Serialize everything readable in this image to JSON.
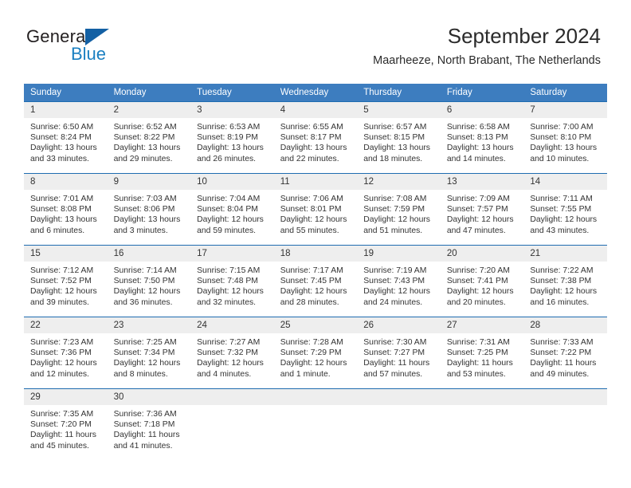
{
  "brand": {
    "name_part1": "General",
    "name_part2": "Blue",
    "flag_icon": "blue-triangle-flag-icon"
  },
  "header": {
    "title": "September 2024",
    "subtitle": "Maarheeze, North Brabant, The Netherlands"
  },
  "colors": {
    "header_blue": "#3d7dbf",
    "row_divider_blue": "#1f6cb0",
    "daynum_band": "#eeeeee",
    "brand_blue": "#1a7fc1"
  },
  "weekdays": [
    "Sunday",
    "Monday",
    "Tuesday",
    "Wednesday",
    "Thursday",
    "Friday",
    "Saturday"
  ],
  "weeks": [
    [
      {
        "day": "1",
        "sunrise": "Sunrise: 6:50 AM",
        "sunset": "Sunset: 8:24 PM",
        "daylight1": "Daylight: 13 hours",
        "daylight2": "and 33 minutes."
      },
      {
        "day": "2",
        "sunrise": "Sunrise: 6:52 AM",
        "sunset": "Sunset: 8:22 PM",
        "daylight1": "Daylight: 13 hours",
        "daylight2": "and 29 minutes."
      },
      {
        "day": "3",
        "sunrise": "Sunrise: 6:53 AM",
        "sunset": "Sunset: 8:19 PM",
        "daylight1": "Daylight: 13 hours",
        "daylight2": "and 26 minutes."
      },
      {
        "day": "4",
        "sunrise": "Sunrise: 6:55 AM",
        "sunset": "Sunset: 8:17 PM",
        "daylight1": "Daylight: 13 hours",
        "daylight2": "and 22 minutes."
      },
      {
        "day": "5",
        "sunrise": "Sunrise: 6:57 AM",
        "sunset": "Sunset: 8:15 PM",
        "daylight1": "Daylight: 13 hours",
        "daylight2": "and 18 minutes."
      },
      {
        "day": "6",
        "sunrise": "Sunrise: 6:58 AM",
        "sunset": "Sunset: 8:13 PM",
        "daylight1": "Daylight: 13 hours",
        "daylight2": "and 14 minutes."
      },
      {
        "day": "7",
        "sunrise": "Sunrise: 7:00 AM",
        "sunset": "Sunset: 8:10 PM",
        "daylight1": "Daylight: 13 hours",
        "daylight2": "and 10 minutes."
      }
    ],
    [
      {
        "day": "8",
        "sunrise": "Sunrise: 7:01 AM",
        "sunset": "Sunset: 8:08 PM",
        "daylight1": "Daylight: 13 hours",
        "daylight2": "and 6 minutes."
      },
      {
        "day": "9",
        "sunrise": "Sunrise: 7:03 AM",
        "sunset": "Sunset: 8:06 PM",
        "daylight1": "Daylight: 13 hours",
        "daylight2": "and 3 minutes."
      },
      {
        "day": "10",
        "sunrise": "Sunrise: 7:04 AM",
        "sunset": "Sunset: 8:04 PM",
        "daylight1": "Daylight: 12 hours",
        "daylight2": "and 59 minutes."
      },
      {
        "day": "11",
        "sunrise": "Sunrise: 7:06 AM",
        "sunset": "Sunset: 8:01 PM",
        "daylight1": "Daylight: 12 hours",
        "daylight2": "and 55 minutes."
      },
      {
        "day": "12",
        "sunrise": "Sunrise: 7:08 AM",
        "sunset": "Sunset: 7:59 PM",
        "daylight1": "Daylight: 12 hours",
        "daylight2": "and 51 minutes."
      },
      {
        "day": "13",
        "sunrise": "Sunrise: 7:09 AM",
        "sunset": "Sunset: 7:57 PM",
        "daylight1": "Daylight: 12 hours",
        "daylight2": "and 47 minutes."
      },
      {
        "day": "14",
        "sunrise": "Sunrise: 7:11 AM",
        "sunset": "Sunset: 7:55 PM",
        "daylight1": "Daylight: 12 hours",
        "daylight2": "and 43 minutes."
      }
    ],
    [
      {
        "day": "15",
        "sunrise": "Sunrise: 7:12 AM",
        "sunset": "Sunset: 7:52 PM",
        "daylight1": "Daylight: 12 hours",
        "daylight2": "and 39 minutes."
      },
      {
        "day": "16",
        "sunrise": "Sunrise: 7:14 AM",
        "sunset": "Sunset: 7:50 PM",
        "daylight1": "Daylight: 12 hours",
        "daylight2": "and 36 minutes."
      },
      {
        "day": "17",
        "sunrise": "Sunrise: 7:15 AM",
        "sunset": "Sunset: 7:48 PM",
        "daylight1": "Daylight: 12 hours",
        "daylight2": "and 32 minutes."
      },
      {
        "day": "18",
        "sunrise": "Sunrise: 7:17 AM",
        "sunset": "Sunset: 7:45 PM",
        "daylight1": "Daylight: 12 hours",
        "daylight2": "and 28 minutes."
      },
      {
        "day": "19",
        "sunrise": "Sunrise: 7:19 AM",
        "sunset": "Sunset: 7:43 PM",
        "daylight1": "Daylight: 12 hours",
        "daylight2": "and 24 minutes."
      },
      {
        "day": "20",
        "sunrise": "Sunrise: 7:20 AM",
        "sunset": "Sunset: 7:41 PM",
        "daylight1": "Daylight: 12 hours",
        "daylight2": "and 20 minutes."
      },
      {
        "day": "21",
        "sunrise": "Sunrise: 7:22 AM",
        "sunset": "Sunset: 7:38 PM",
        "daylight1": "Daylight: 12 hours",
        "daylight2": "and 16 minutes."
      }
    ],
    [
      {
        "day": "22",
        "sunrise": "Sunrise: 7:23 AM",
        "sunset": "Sunset: 7:36 PM",
        "daylight1": "Daylight: 12 hours",
        "daylight2": "and 12 minutes."
      },
      {
        "day": "23",
        "sunrise": "Sunrise: 7:25 AM",
        "sunset": "Sunset: 7:34 PM",
        "daylight1": "Daylight: 12 hours",
        "daylight2": "and 8 minutes."
      },
      {
        "day": "24",
        "sunrise": "Sunrise: 7:27 AM",
        "sunset": "Sunset: 7:32 PM",
        "daylight1": "Daylight: 12 hours",
        "daylight2": "and 4 minutes."
      },
      {
        "day": "25",
        "sunrise": "Sunrise: 7:28 AM",
        "sunset": "Sunset: 7:29 PM",
        "daylight1": "Daylight: 12 hours",
        "daylight2": "and 1 minute."
      },
      {
        "day": "26",
        "sunrise": "Sunrise: 7:30 AM",
        "sunset": "Sunset: 7:27 PM",
        "daylight1": "Daylight: 11 hours",
        "daylight2": "and 57 minutes."
      },
      {
        "day": "27",
        "sunrise": "Sunrise: 7:31 AM",
        "sunset": "Sunset: 7:25 PM",
        "daylight1": "Daylight: 11 hours",
        "daylight2": "and 53 minutes."
      },
      {
        "day": "28",
        "sunrise": "Sunrise: 7:33 AM",
        "sunset": "Sunset: 7:22 PM",
        "daylight1": "Daylight: 11 hours",
        "daylight2": "and 49 minutes."
      }
    ],
    [
      {
        "day": "29",
        "sunrise": "Sunrise: 7:35 AM",
        "sunset": "Sunset: 7:20 PM",
        "daylight1": "Daylight: 11 hours",
        "daylight2": "and 45 minutes."
      },
      {
        "day": "30",
        "sunrise": "Sunrise: 7:36 AM",
        "sunset": "Sunset: 7:18 PM",
        "daylight1": "Daylight: 11 hours",
        "daylight2": "and 41 minutes."
      },
      {
        "day": "",
        "sunrise": "",
        "sunset": "",
        "daylight1": "",
        "daylight2": ""
      },
      {
        "day": "",
        "sunrise": "",
        "sunset": "",
        "daylight1": "",
        "daylight2": ""
      },
      {
        "day": "",
        "sunrise": "",
        "sunset": "",
        "daylight1": "",
        "daylight2": ""
      },
      {
        "day": "",
        "sunrise": "",
        "sunset": "",
        "daylight1": "",
        "daylight2": ""
      },
      {
        "day": "",
        "sunrise": "",
        "sunset": "",
        "daylight1": "",
        "daylight2": ""
      }
    ]
  ]
}
